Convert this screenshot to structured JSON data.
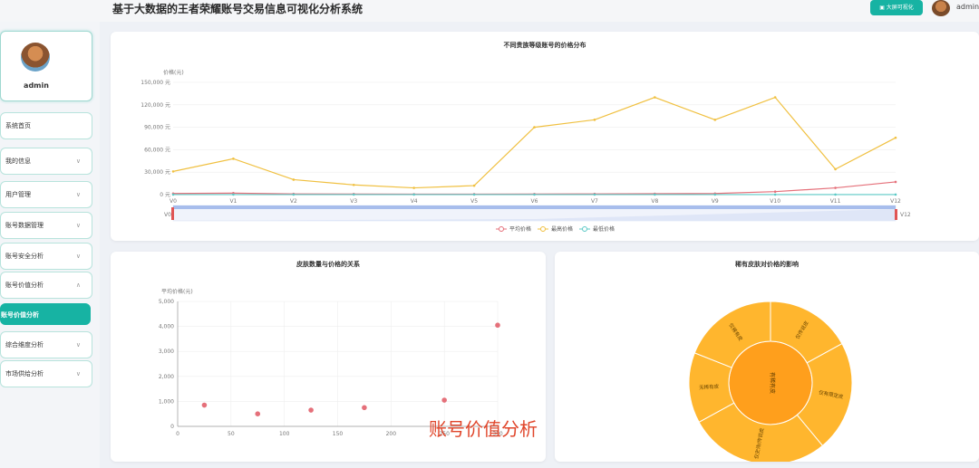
{
  "header": {
    "title": "基于大数据的王者荣耀账号交易信息可视化分析系统",
    "bigscreen_button": "大屏可视化",
    "username": "admin"
  },
  "sidebar": {
    "username": "admin",
    "items": [
      {
        "label": "系统首页",
        "chevron": false
      },
      {
        "label": "我的信息",
        "chevron": true
      },
      {
        "label": "用户管理",
        "chevron": true
      },
      {
        "label": "账号数据管理",
        "chevron": true
      },
      {
        "label": "账号安全分析",
        "chevron": true
      },
      {
        "label": "账号价值分析",
        "chevron": "up"
      },
      {
        "label": "账号价值分析",
        "active": true
      },
      {
        "label": "综合维度分析",
        "chevron": true
      },
      {
        "label": "市场供给分析",
        "chevron": true
      }
    ]
  },
  "watermark": "账号价值分析",
  "chart_data": [
    {
      "type": "line",
      "title": "不同贵族等级账号的价格分布",
      "ylabel": "价格(元)",
      "categories": [
        "V0",
        "V1",
        "V2",
        "V3",
        "V4",
        "V5",
        "V6",
        "V7",
        "V8",
        "V9",
        "V10",
        "V11",
        "V12"
      ],
      "ylim": [
        0,
        150000
      ],
      "yticks": [
        "0 元",
        "30,000 元",
        "60,000 元",
        "90,000 元",
        "120,000 元",
        "150,000 元"
      ],
      "series": [
        {
          "name": "平均价格",
          "color": "#e5707a",
          "values": [
            1500,
            2000,
            1000,
            800,
            600,
            700,
            800,
            1000,
            1200,
            1500,
            4000,
            9000,
            17000
          ]
        },
        {
          "name": "最高价格",
          "color": "#f0c040",
          "values": [
            31000,
            48000,
            20000,
            13000,
            9000,
            12000,
            90000,
            100000,
            130000,
            100000,
            130000,
            34000,
            76000
          ]
        },
        {
          "name": "最低价格",
          "color": "#5cc9c6",
          "values": [
            100,
            100,
            100,
            100,
            100,
            100,
            100,
            100,
            100,
            100,
            100,
            100,
            100
          ]
        }
      ],
      "datazoom": {
        "start_label": "V0",
        "end_label": "V12"
      },
      "grid": true,
      "legend": "bottom"
    },
    {
      "type": "scatter",
      "title": "皮肤数量与价格的关系",
      "ylabel": "平均价格(元)",
      "xlim": [
        0,
        300
      ],
      "ylim": [
        0,
        5000
      ],
      "xticks": [
        "0",
        "50",
        "100",
        "150",
        "200",
        "250",
        "300"
      ],
      "yticks": [
        "0",
        "1,000",
        "2,000",
        "3,000",
        "4,000",
        "5,000"
      ],
      "color": "#e5707a",
      "points": [
        [
          25,
          850
        ],
        [
          75,
          500
        ],
        [
          125,
          650
        ],
        [
          175,
          750
        ],
        [
          250,
          1050
        ],
        [
          300,
          4050
        ]
      ],
      "grid": true
    },
    {
      "type": "pie",
      "title": "稀有皮肤对价格的影响",
      "inner": [
        {
          "label": "有稀有皮",
          "value": 1
        }
      ],
      "outer": [
        {
          "label": "仅传说皮",
          "value": 0.17
        },
        {
          "label": "仅有限定皮",
          "value": 0.22
        },
        {
          "label": "仅史诗/传说皮",
          "value": 0.28
        },
        {
          "label": "无稀有皮",
          "value": 0.14
        },
        {
          "label": "仅稀有皮",
          "value": 0.19
        }
      ],
      "colors": {
        "inner": "#ff9f1c",
        "outer": "#ffb62e"
      }
    }
  ]
}
